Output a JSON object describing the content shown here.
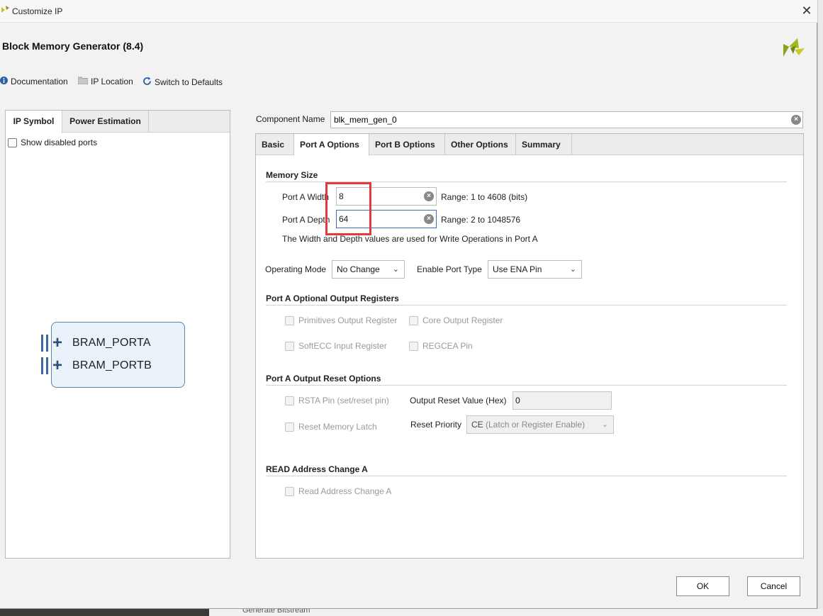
{
  "window": {
    "title": "Customize IP",
    "close_glyph": "✕"
  },
  "header": {
    "title": "Block Memory Generator (8.4)"
  },
  "toolbar": {
    "documentation": "Documentation",
    "ip_location": "IP Location",
    "switch_defaults": "Switch to Defaults"
  },
  "left_panel": {
    "tabs": [
      {
        "label": "IP Symbol",
        "active": true
      },
      {
        "label": "Power Estimation",
        "active": false
      }
    ],
    "show_disabled_ports": "Show disabled ports",
    "ports": [
      "BRAM_PORTA",
      "BRAM_PORTB"
    ]
  },
  "component": {
    "label": "Component Name",
    "value": "blk_mem_gen_0"
  },
  "tabs": [
    {
      "label": "Basic",
      "active": false
    },
    {
      "label": "Port A Options",
      "active": true
    },
    {
      "label": "Port B Options",
      "active": false
    },
    {
      "label": "Other Options",
      "active": false
    },
    {
      "label": "Summary",
      "active": false
    }
  ],
  "memory_size": {
    "title": "Memory Size",
    "width_label": "Port A Width",
    "width_value": "8",
    "width_range": "Range: 1 to 4608 (bits)",
    "depth_label": "Port A Depth",
    "depth_value": "64",
    "depth_range": "Range: 2 to 1048576",
    "note": "The Width and Depth values are used for Write Operations in Port A"
  },
  "operating": {
    "mode_label": "Operating Mode",
    "mode_value": "No Change",
    "enable_label": "Enable Port Type",
    "enable_value": "Use ENA Pin"
  },
  "output_registers": {
    "title": "Port A Optional Output Registers",
    "primitives": "Primitives Output Register",
    "core": "Core Output Register",
    "softecc": "SoftECC Input Register",
    "regcea": "REGCEA Pin"
  },
  "reset": {
    "title": "Port A Output Reset Options",
    "rsta": "RSTA Pin (set/reset pin)",
    "reset_value_label": "Output Reset Value (Hex)",
    "reset_value": "0",
    "memory_latch": "Reset Memory Latch",
    "priority_label": "Reset Priority",
    "priority_value_code": "CE",
    "priority_value_desc": "(Latch or Register Enable)"
  },
  "read_address": {
    "title": "READ Address Change A",
    "checkbox": "Read Address Change A"
  },
  "buttons": {
    "ok": "OK",
    "cancel": "Cancel"
  },
  "background": {
    "status_text": "Generate Bitstream"
  },
  "colors": {
    "highlight": "#e23b3b",
    "focus": "#3a6fc4",
    "xilinx_logo": "#a6b520"
  }
}
